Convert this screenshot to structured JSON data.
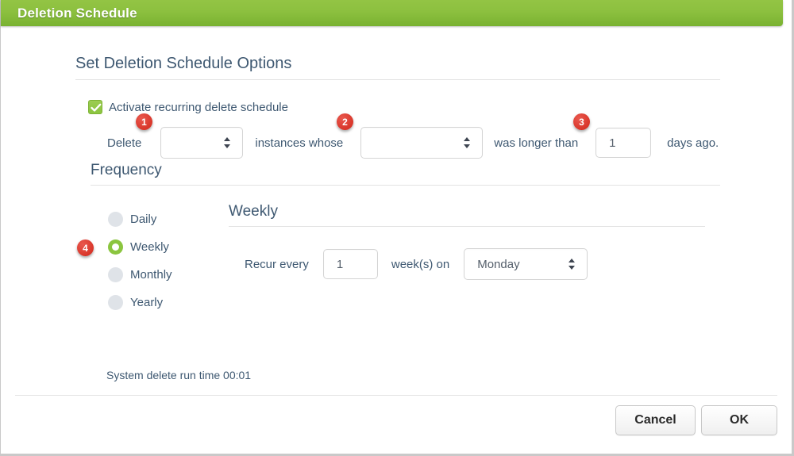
{
  "window": {
    "title": "Deletion Schedule"
  },
  "options": {
    "heading": "Set Deletion Schedule Options",
    "activate_checkbox_label": "Activate recurring delete schedule",
    "activate_checked": true,
    "rule": {
      "delete_label": "Delete",
      "scope_select_value": "",
      "instances_whose_label": "instances whose",
      "field_select_value": "",
      "was_longer_than_label": "was longer than",
      "days_value": "1",
      "days_ago_label": "days ago."
    }
  },
  "frequency": {
    "heading": "Frequency",
    "selected": "Weekly",
    "options": [
      {
        "label": "Daily",
        "selected": false
      },
      {
        "label": "Weekly",
        "selected": true
      },
      {
        "label": "Monthly",
        "selected": false
      },
      {
        "label": "Yearly",
        "selected": false
      }
    ]
  },
  "weekly_panel": {
    "heading": "Weekly",
    "recur_every_label": "Recur every",
    "weeks_value": "1",
    "weeks_on_label": "week(s) on",
    "day_value": "Monday"
  },
  "runtime_note": "System delete run time 00:01",
  "footer": {
    "cancel_label": "Cancel",
    "ok_label": "OK"
  },
  "badges": [
    {
      "number": "1"
    },
    {
      "number": "2"
    },
    {
      "number": "3"
    },
    {
      "number": "4"
    }
  ],
  "colors": {
    "title_bar_green": "#8cc03f",
    "accent_green": "#8bc53f",
    "badge_red": "#d9362a",
    "text_blue_gray": "#3e5871"
  }
}
